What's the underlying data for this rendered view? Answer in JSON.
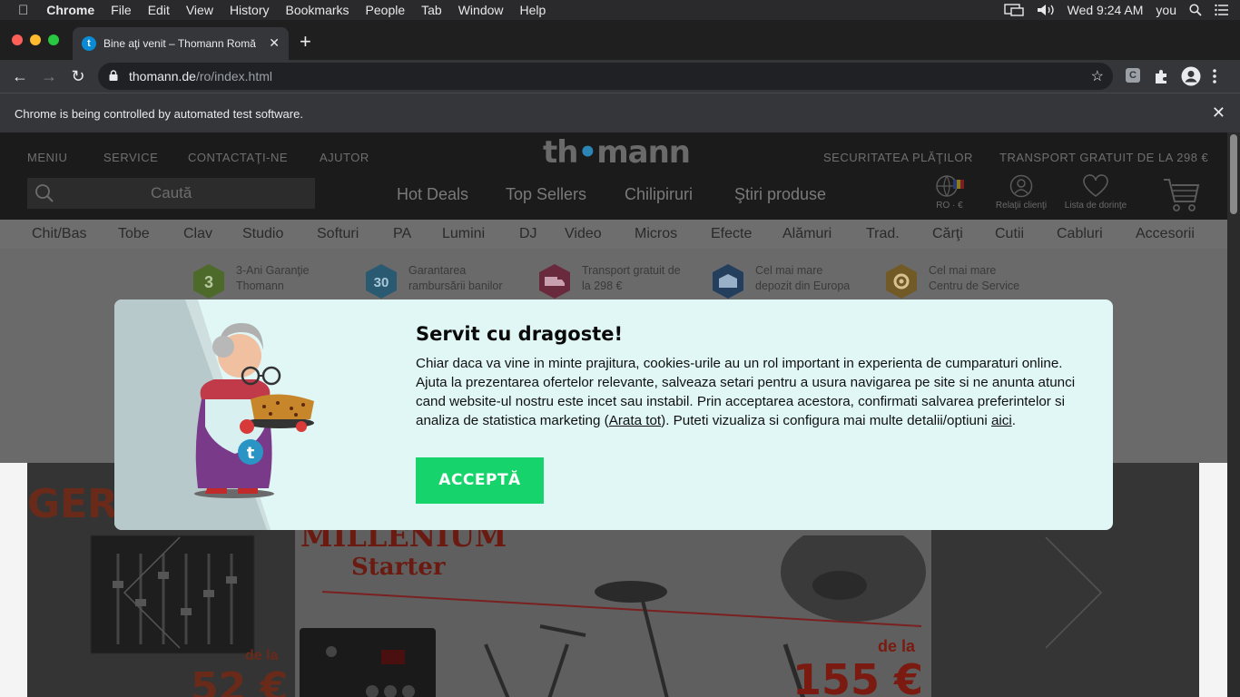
{
  "menubar": {
    "app": "Chrome",
    "items": [
      "File",
      "Edit",
      "View",
      "History",
      "Bookmarks",
      "People",
      "Tab",
      "Window",
      "Help"
    ],
    "clock": "Wed 9:24 AM",
    "user": "you"
  },
  "tab": {
    "title": "Bine aţi venit – Thomann Romă",
    "favicon": "t"
  },
  "omnibox": {
    "url_host": "thomann.de",
    "url_path": "/ro/index.html"
  },
  "toolbar": {
    "extension_label": "C"
  },
  "infobar": {
    "message": "Chrome is being controlled by automated test software."
  },
  "site": {
    "top_links": [
      "MENIU",
      "SERVICE",
      "CONTACTAŢI-NE",
      "AJUTOR"
    ],
    "top_right_links": [
      "SECURITATEA PLĂŢILOR",
      "TRANSPORT GRATUIT DE LA 298 €"
    ],
    "logo": "thomann",
    "search_placeholder": "Caută",
    "hot_links": [
      "Hot Deals",
      "Top Sellers",
      "Chilipiruri",
      "Ştiri produse"
    ],
    "header_icons": {
      "locale": "RO · €",
      "customer": "Relaţii clienţi",
      "wishlist": "Lista de dorinţe"
    },
    "categories": [
      "Chit/Bas",
      "Tobe",
      "Clav",
      "Studio",
      "Softuri",
      "PA",
      "Lumini",
      "DJ",
      "Video",
      "Micros",
      "Efecte",
      "Alămuri",
      "Trad.",
      "Cărţi",
      "Cutii",
      "Cabluri",
      "Accesorii"
    ],
    "usps": [
      {
        "icon": "3",
        "line1": "3-Ani Garanţie",
        "line2": "Thomann",
        "color": "#7bb43a"
      },
      {
        "icon": "30",
        "line1": "Garantarea",
        "line2": "rambursării banilor",
        "color": "#3aa0d0"
      },
      {
        "icon": "truck",
        "line1": "Transport gratuit de",
        "line2": "la 298 €",
        "color": "#d03a6a"
      },
      {
        "icon": "warehouse",
        "line1": "Cel mai mare",
        "line2": "depozit din Europa",
        "color": "#2a6ab0"
      },
      {
        "icon": "gear",
        "line1": "Cel mai mare",
        "line2": "Centru de Service",
        "color": "#e8a020"
      }
    ]
  },
  "cookie_modal": {
    "title": "Servit cu dragoste!",
    "body_1": "Chiar daca va vine in minte prajitura, cookies-urile au un rol important in experienta de cumparaturi online. Ajuta la prezentarea ofertelor relevante, salveaza setari pentru a usura navigarea pe site si ne anunta atunci cand website-ul nostru este incet sau instabil. Prin acceptarea acestora, confirmati salvarea preferintelor si analiza de statistica marketing (",
    "link_1": "Arata tot",
    "body_2": "). Puteti vizualiza si configura mai multe detalii/optiuni ",
    "link_2": "aici",
    "body_3": ".",
    "accept_label": "ACCEPTĂ"
  },
  "banners": {
    "left_text": "GER",
    "left_price_prefix": "de la",
    "left_price": "52 €",
    "center_title": "MILLENIUM",
    "center_subtitle": "Starter",
    "right_price_prefix": "de la",
    "right_price": "155 €"
  }
}
